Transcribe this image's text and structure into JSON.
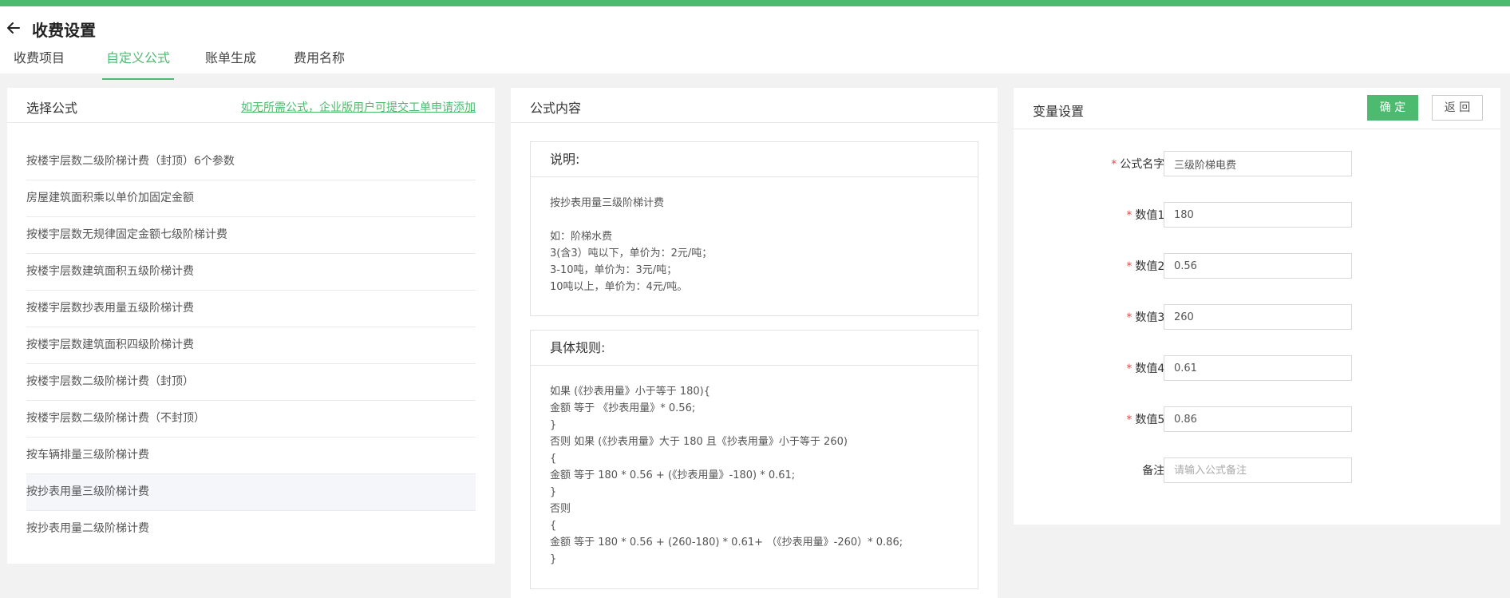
{
  "colors": {
    "accent": "#4cbb6f",
    "required": "#ee4444"
  },
  "header": {
    "title": "收费设置",
    "back_icon": "arrow-left-icon"
  },
  "tabs": [
    {
      "label": "收费项目",
      "active": false
    },
    {
      "label": "自定义公式",
      "active": true
    },
    {
      "label": "账单生成",
      "active": false
    },
    {
      "label": "费用名称",
      "active": false
    }
  ],
  "select_panel": {
    "title": "选择公式",
    "hint_link": "如无所需公式，企业版用户可提交工单申请添加",
    "items": [
      "按楼宇层数二级阶梯计费（封顶）6个参数",
      "房屋建筑面积乘以单价加固定金额",
      "按楼宇层数无规律固定金额七级阶梯计费",
      "按楼宇层数建筑面积五级阶梯计费",
      "按楼宇层数抄表用量五级阶梯计费",
      "按楼宇层数建筑面积四级阶梯计费",
      "按楼宇层数二级阶梯计费（封顶）",
      "按楼宇层数二级阶梯计费（不封顶）",
      "按车辆排量三级阶梯计费",
      "按抄表用量三级阶梯计费",
      "按抄表用量二级阶梯计费"
    ],
    "selected_index": 9
  },
  "content_panel": {
    "title": "公式内容",
    "desc_title": "说明:",
    "desc_text": "按抄表用量三级阶梯计费\n\n如：阶梯水费\n3(含3）吨以下，单价为：2元/吨；\n3-10吨，单价为：3元/吨；\n10吨以上，单价为：4元/吨。",
    "rule_title": "具体规则:",
    "rule_text": "如果 (《抄表用量》小于等于 180){\n金额 等于 《抄表用量》* 0.56;\n}\n否则 如果 (《抄表用量》大于 180 且《抄表用量》小于等于 260)\n{\n金额 等于 180 * 0.56 + (《抄表用量》-180) * 0.61;\n}\n否则\n{\n金额 等于 180 * 0.56 + (260-180) * 0.61+ （《抄表用量》-260）* 0.86;\n}"
  },
  "variable_panel": {
    "title": "变量设置",
    "confirm_label": "确 定",
    "back_label": "返 回",
    "fields": [
      {
        "label": "公式名字:",
        "value": "三级阶梯电费",
        "placeholder": "",
        "required": true
      },
      {
        "label": "数值1:",
        "value": "180",
        "placeholder": "",
        "required": true
      },
      {
        "label": "数值2:",
        "value": "0.56",
        "placeholder": "",
        "required": true
      },
      {
        "label": "数值3:",
        "value": "260",
        "placeholder": "",
        "required": true
      },
      {
        "label": "数值4:",
        "value": "0.61",
        "placeholder": "",
        "required": true
      },
      {
        "label": "数值5:",
        "value": "0.86",
        "placeholder": "",
        "required": true
      },
      {
        "label": "备注:",
        "value": "",
        "placeholder": "请输入公式备注",
        "required": false
      }
    ]
  }
}
